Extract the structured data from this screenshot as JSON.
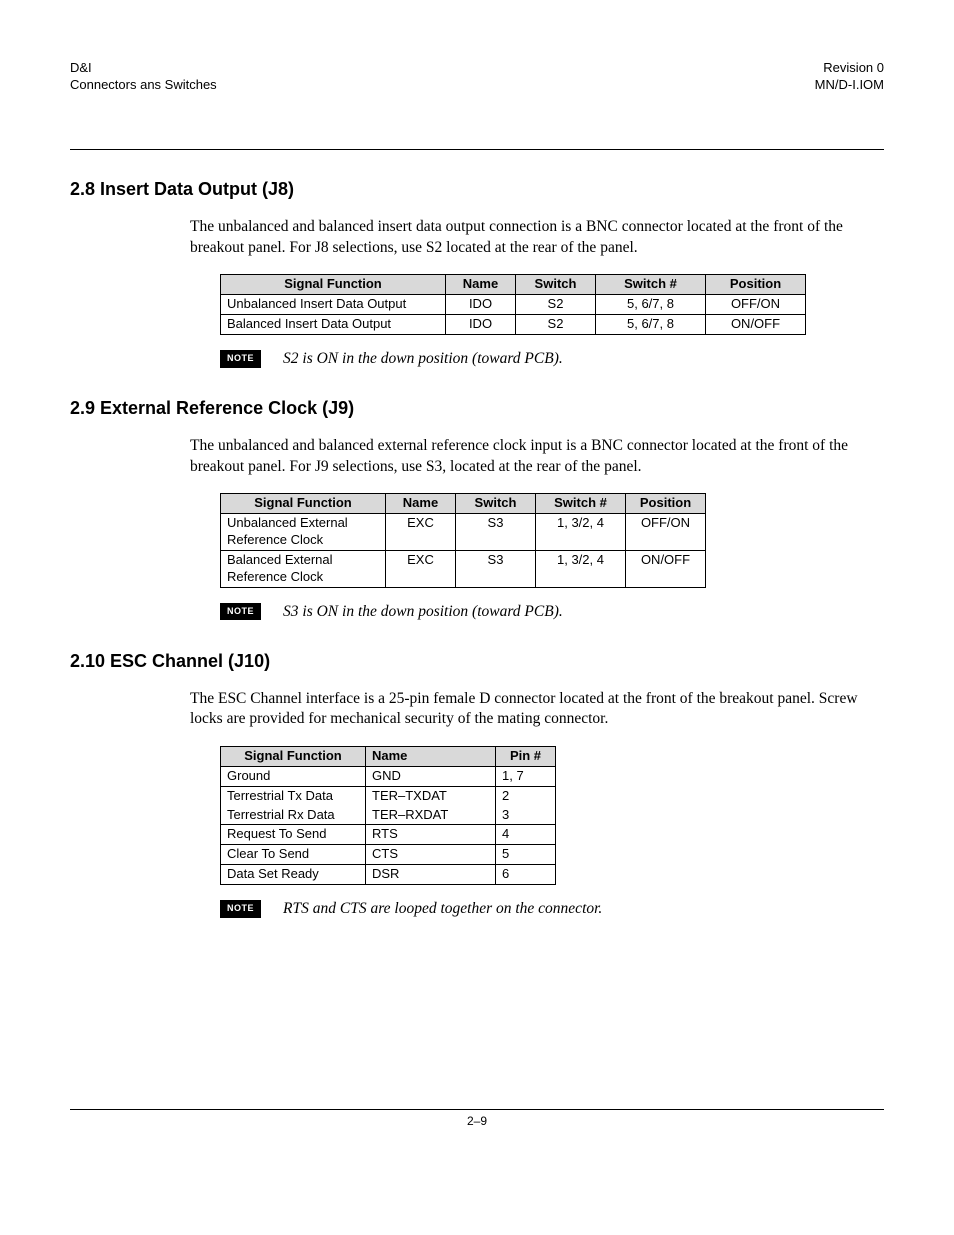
{
  "header": {
    "left_top": "D&I",
    "left_bottom": "Connectors ans Switches",
    "right_top": "Revision 0",
    "right_bottom": "MN/D-I.IOM"
  },
  "section_2_8": {
    "heading": "2.8  Insert Data Output (J8)",
    "paragraph": "The unbalanced and balanced insert data output connection is a BNC connector located at the front of the breakout panel. For J8 selections, use S2 located at the rear of the panel.",
    "table": {
      "headers": [
        "Signal Function",
        "Name",
        "Switch",
        "Switch #",
        "Position"
      ],
      "rows": [
        [
          "Unbalanced Insert Data Output",
          "IDO",
          "S2",
          "5, 6/7, 8",
          "OFF/ON"
        ],
        [
          "Balanced Insert Data Output",
          "IDO",
          "S2",
          "5, 6/7, 8",
          "ON/OFF"
        ]
      ]
    },
    "note_badge": "NOTE",
    "note_text": "S2 is ON in the down position (toward PCB)."
  },
  "section_2_9": {
    "heading": "2.9  External Reference Clock (J9)",
    "paragraph": "The unbalanced and balanced external reference clock input is a BNC connector located at the front of the breakout panel. For J9 selections, use S3, located at the rear of the panel.",
    "table": {
      "headers": [
        "Signal Function",
        "Name",
        "Switch",
        "Switch #",
        "Position"
      ],
      "rows": [
        [
          "Unbalanced External Reference Clock",
          "EXC",
          "S3",
          "1, 3/2, 4",
          "OFF/ON"
        ],
        [
          "Balanced External Reference Clock",
          "EXC",
          "S3",
          "1, 3/2, 4",
          "ON/OFF"
        ]
      ]
    },
    "note_badge": "NOTE",
    "note_text": "S3 is ON in the down position (toward PCB)."
  },
  "section_2_10": {
    "heading": "2.10  ESC Channel (J10)",
    "paragraph": "The ESC Channel interface is a 25-pin female D connector located at the front of the breakout panel. Screw locks are provided for mechanical security of the mating connector.",
    "table": {
      "headers": [
        "Signal Function",
        "Name",
        "Pin #"
      ],
      "rows": [
        [
          "Ground",
          "GND",
          "1, 7"
        ],
        [
          "Terrestrial Tx Data",
          "TER–TXDAT",
          "2"
        ],
        [
          "Terrestrial Rx Data",
          "TER–RXDAT",
          "3"
        ],
        [
          "Request To Send",
          "RTS",
          "4"
        ],
        [
          "Clear To Send",
          "CTS",
          "5"
        ],
        [
          "Data Set Ready",
          "DSR",
          "6"
        ]
      ]
    },
    "note_badge": "NOTE",
    "note_text": "RTS and CTS are looped together on the connector."
  },
  "footer": {
    "page_number": "2–9"
  }
}
